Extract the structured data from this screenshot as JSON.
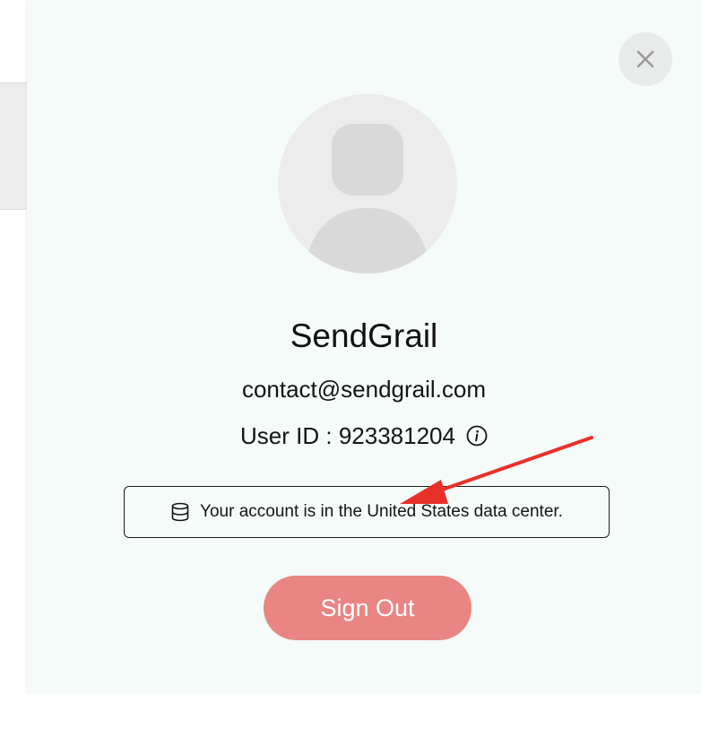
{
  "profile": {
    "org_name": "SendGrail",
    "email": "contact@sendgrail.com",
    "user_id_label": "User ID : 923381204",
    "data_center_notice": "Your account is in the United States data center.",
    "sign_out_label": "Sign Out"
  },
  "icons": {
    "close": "close-icon",
    "avatar": "user-placeholder-icon",
    "info": "info-icon",
    "database": "database-icon"
  },
  "colors": {
    "panel_background": "#f5fbf9",
    "sign_out_button": "#e98583",
    "annotation_arrow": "#e8302a"
  }
}
